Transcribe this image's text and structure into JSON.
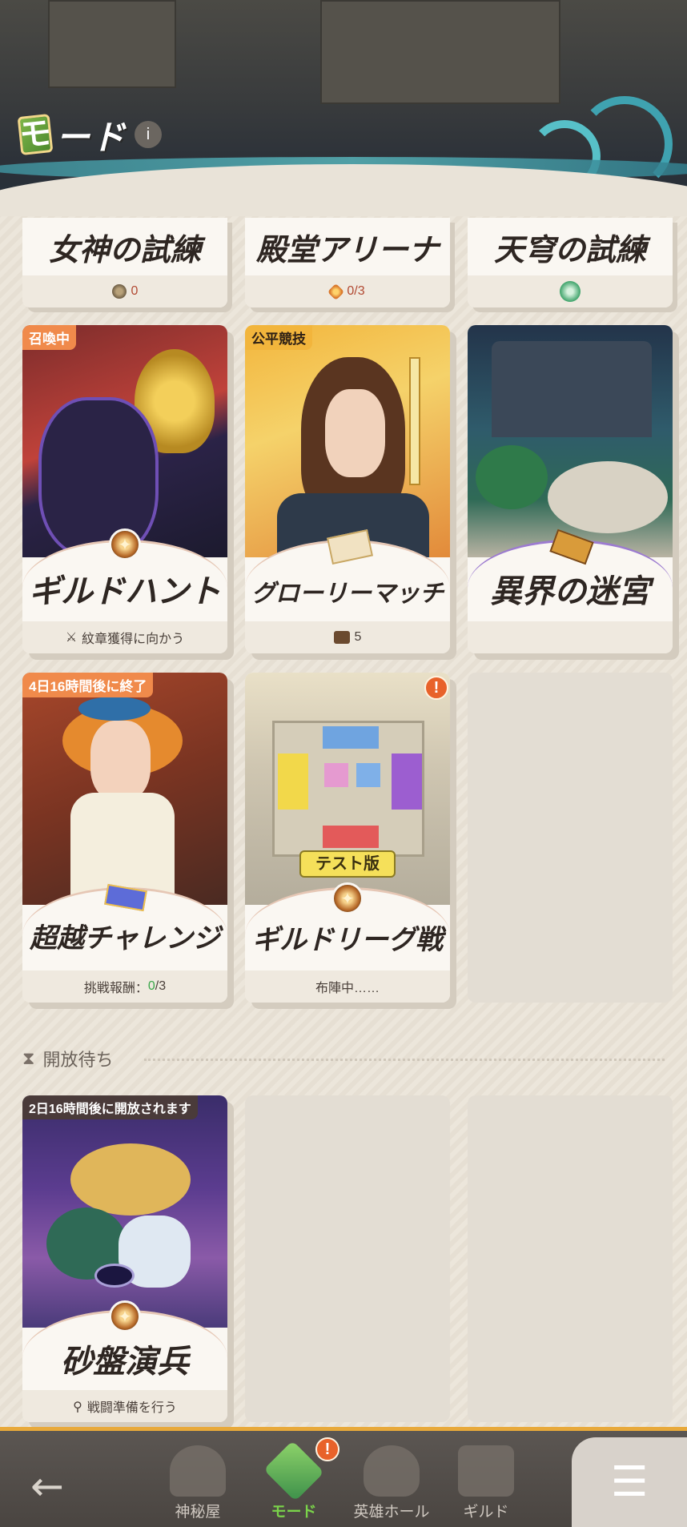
{
  "header": {
    "title": "モード",
    "logo_glyph": "モ",
    "title_rest": "ード",
    "info": "i"
  },
  "top_modes": [
    {
      "name": "女神の試練",
      "reward_icon": "coin-icon",
      "reward": "0"
    },
    {
      "name": "殿堂アリーナ",
      "reward_icon": "ticket-icon",
      "reward": "0/3"
    },
    {
      "name": "天穹の試練",
      "reward_icon": "green-orb-icon",
      "reward": ""
    }
  ],
  "modes": [
    {
      "name": "ギルドハント",
      "tag": "召喚中",
      "footer": "紋章獲得に向かう"
    },
    {
      "name": "グローリーマッチ",
      "tag": "公平競技",
      "footer": "5"
    },
    {
      "name": "異界の迷宮",
      "tag": "",
      "footer": ""
    },
    {
      "name": "超越チャレンジ",
      "tag": "4日16時間後に終了",
      "footer_prefix": "挑戦報酬：",
      "footer_value": "0",
      "footer_suffix": "/3"
    },
    {
      "name": "ギルドリーグ戦",
      "tag": "",
      "badge": "!",
      "sub_label": "テスト版",
      "footer": "布陣中……"
    }
  ],
  "pending_section": {
    "title": "開放待ち"
  },
  "pending_modes": [
    {
      "name": "砂盤演兵",
      "tag": "2日16時間後に開放されます",
      "footer": "戦闘準備を行う"
    }
  ],
  "nav": {
    "back": "←",
    "items": [
      {
        "label": "神秘屋"
      },
      {
        "label": "モード",
        "badge": "!"
      },
      {
        "label": "英雄ホール"
      },
      {
        "label": "ギルド"
      }
    ],
    "menu": "☰"
  },
  "colors": {
    "accent_green": "#7ad34a",
    "tag_orange": "#f08a4b",
    "tag_gold": "#f2b53c",
    "badge": "#e8622a"
  }
}
